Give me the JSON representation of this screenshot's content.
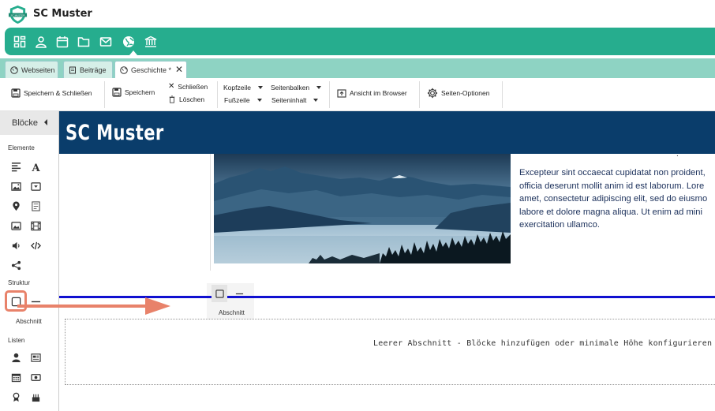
{
  "app": {
    "title": "SC Muster",
    "logo_text": "SC MUSTER"
  },
  "mainnav": {
    "icons": [
      "dashboard-icon",
      "user-icon",
      "calendar-icon",
      "folder-icon",
      "mail-icon",
      "globe-icon",
      "bank-icon"
    ],
    "active": "globe-icon"
  },
  "tabs": [
    {
      "label": "Webseiten",
      "icon": "globe-icon"
    },
    {
      "label": "Beiträge",
      "icon": "document-icon"
    },
    {
      "label": "Geschichte *",
      "icon": "globe-icon",
      "active": true
    }
  ],
  "toolbar": {
    "save_close": "Speichern & Schließen",
    "save": "Speichern",
    "close": "Schließen",
    "delete": "Löschen",
    "header": "Kopfzeile",
    "footer": "Fußzeile",
    "sidebar": "Seitenbalken",
    "page_content": "Seiteninhalt",
    "browser_view": "Ansicht im Browser",
    "page_options": "Seiten-Optionen"
  },
  "sidebar": {
    "header": "Blöcke",
    "groups": {
      "elements": "Elemente",
      "structure": "Struktur",
      "lists": "Listen"
    },
    "section_label": "Abschnitt"
  },
  "canvas": {
    "site_title": "SC Muster",
    "sliver_text": ".",
    "article_lines": [
      "Excepteur sint occaecat cupidatat non proident,",
      "officia deserunt mollit anim id est laborum. Lore",
      "amet, consectetur adipiscing elit, sed do eiusmo",
      "labore et dolore magna aliqua. Ut enim ad mini",
      "exercitation ullamco."
    ],
    "section_tool_label": "Abschnitt",
    "empty_section_text": "Leerer Abschnitt - Blöcke hinzufügen oder minimale Höhe konfigurieren"
  },
  "colors": {
    "nav": "#26ad8e",
    "tabbar": "#8ed3c3",
    "header": "#0a3d6b",
    "highlight": "#e8826a",
    "drop_line": "#1010d0"
  }
}
